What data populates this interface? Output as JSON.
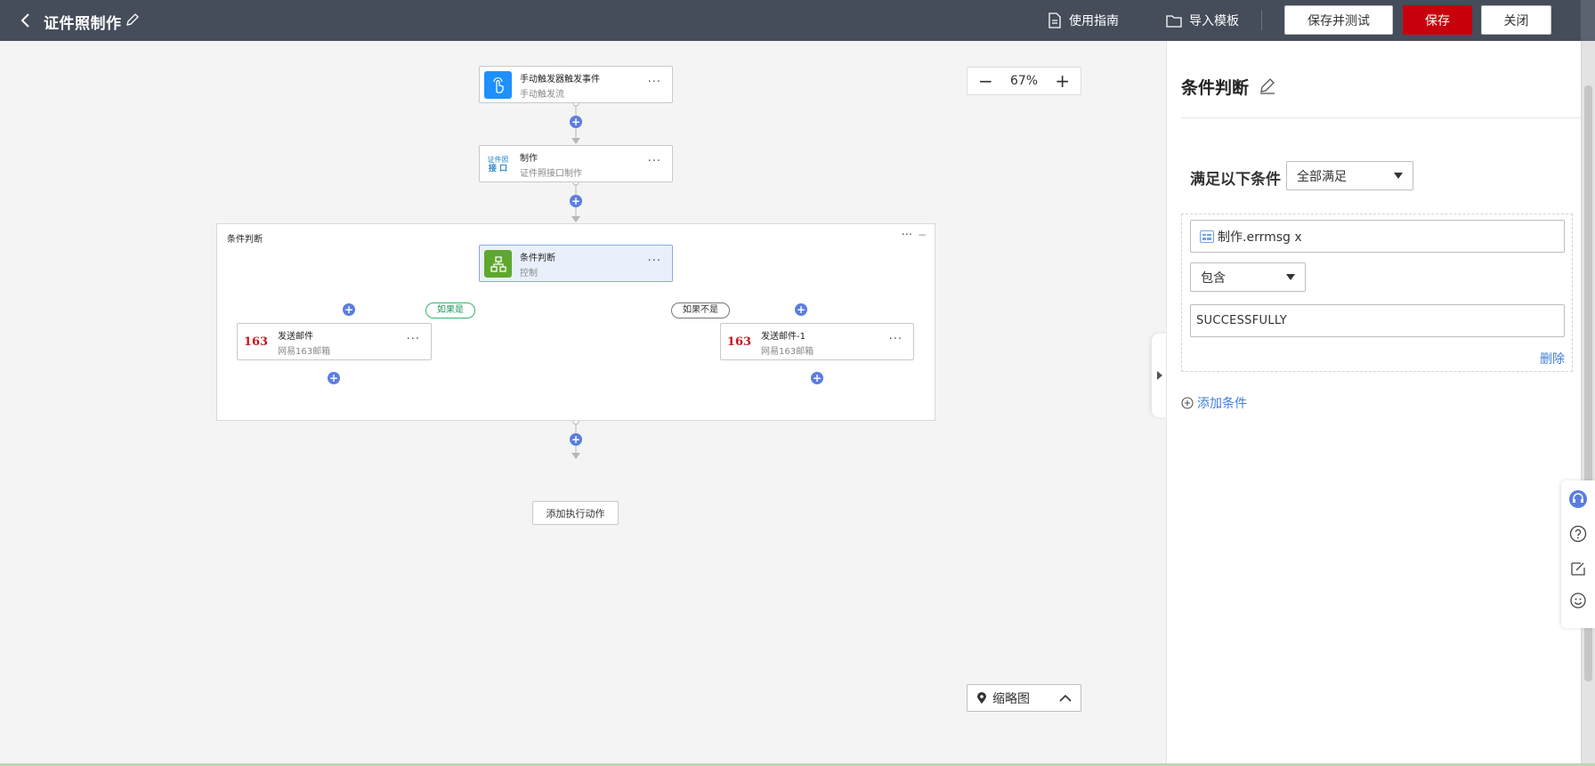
{
  "header": {
    "title": "证件照制作",
    "guide_label": "使用指南",
    "import_label": "导入模板",
    "save_test_label": "保存并测试",
    "save_label": "保存",
    "close_label": "关闭"
  },
  "canvas": {
    "zoom": "67%",
    "minimap_label": "缩略图",
    "add_action_label": "添加执行动作",
    "nodes": {
      "trigger": {
        "title": "手动触发器触发事件",
        "subtitle": "手动触发流",
        "icon": "hand-pointer-icon",
        "icon_color": "#1e90ff"
      },
      "make": {
        "title": "制作",
        "subtitle": "证件照接口制作",
        "icon_text_1": "证件照",
        "icon_text_2": "接 口"
      },
      "condition": {
        "title": "条件判断",
        "subtitle": "控制",
        "icon": "flow-branch-icon",
        "icon_color": "#5fa82f"
      },
      "mail_left": {
        "title": "发送邮件",
        "subtitle": "网易163邮箱",
        "icon_text": "163"
      },
      "mail_right": {
        "title": "发送邮件-1",
        "subtitle": "网易163邮箱",
        "icon_text": "163"
      }
    },
    "group_label": "条件判断",
    "branch_yes": "如果是",
    "branch_no": "如果不是"
  },
  "panel": {
    "title": "条件判断",
    "match_label": "满足以下条件",
    "match_mode": "全部满足",
    "field_value": "制作.errmsg x",
    "operator": "包含",
    "compare_value": "SUCCESSFULLY",
    "delete_label": "删除",
    "add_condition_label": "添加条件"
  },
  "colors": {
    "topbar": "#454c5a",
    "primary": "#c7000b",
    "link": "#3f7fd6",
    "plus": "#5a7ee0"
  }
}
